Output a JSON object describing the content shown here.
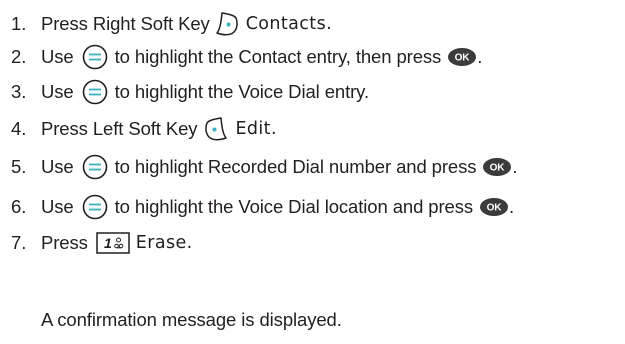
{
  "steps": [
    {
      "number": "1.",
      "before": "Press Right Soft Key",
      "key_label": "Contacts.",
      "icon": "right-soft-key-icon"
    },
    {
      "number": "2.",
      "before": "Use",
      "middle": "to highlight the Contact entry, then press",
      "after": ".",
      "icon": "nav-key-icon",
      "end_icon": "ok-key-icon",
      "ok_label": "OK"
    },
    {
      "number": "3.",
      "before": "Use",
      "middle": "to highlight the Voice Dial entry.",
      "icon": "nav-key-icon"
    },
    {
      "number": "4.",
      "before": "Press Left Soft Key",
      "key_label": "Edit.",
      "icon": "left-soft-key-icon"
    },
    {
      "number": "5.",
      "before": "Use",
      "middle": "to highlight Recorded Dial number and press",
      "after": ".",
      "icon": "nav-key-icon",
      "end_icon": "ok-key-icon",
      "ok_label": "OK"
    },
    {
      "number": "6.",
      "before": "Use",
      "middle": "to highlight the Voice Dial location and press",
      "after": ".",
      "icon": "nav-key-icon",
      "end_icon": "ok-key-icon",
      "ok_label": "OK"
    },
    {
      "number": "7.",
      "before": "Press",
      "key_label": "Erase.",
      "icon": "key-1-voicemail-icon",
      "key_digit": "1"
    }
  ],
  "note": "A confirmation message is displayed.",
  "colors": {
    "text": "#231f20",
    "ok_fill": "#3b3b3b"
  }
}
